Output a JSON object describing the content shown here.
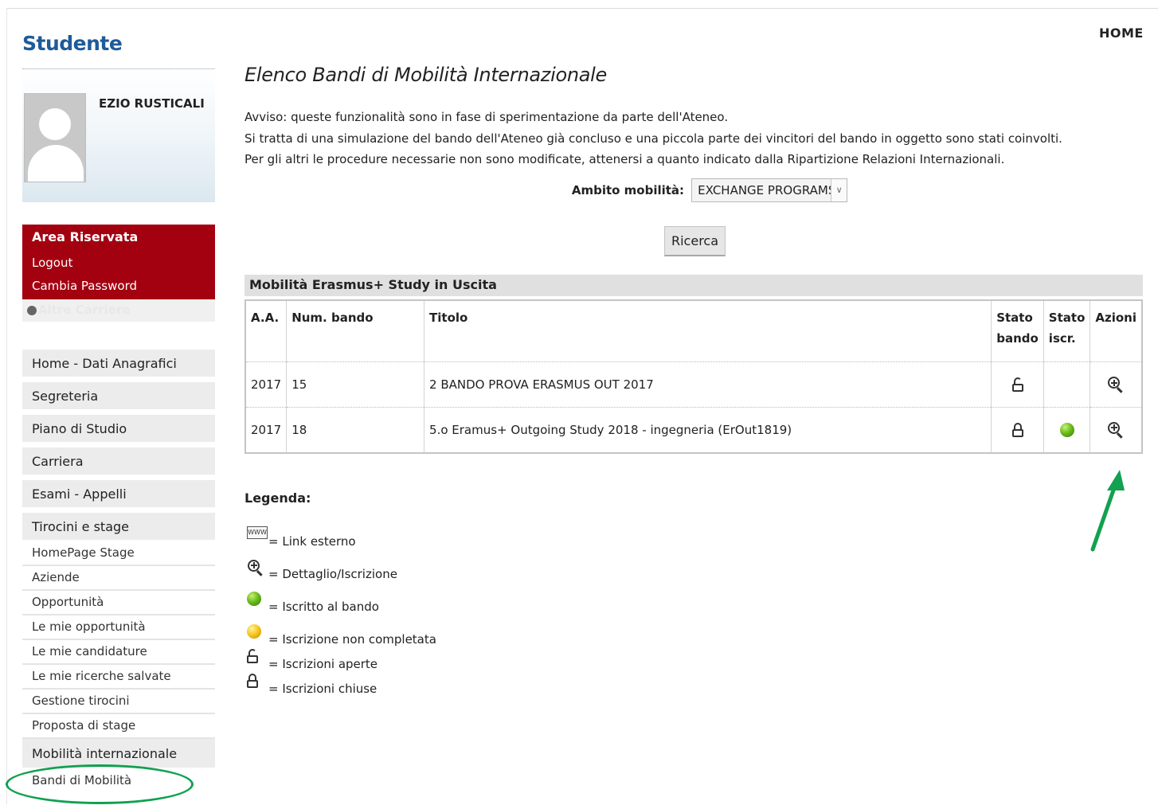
{
  "header": {
    "home_label": "HOME"
  },
  "sidebar": {
    "title": "Studente",
    "user_name": "EZIO RUSTICALI",
    "reserved": {
      "title": "Area Riservata",
      "logout": "Logout",
      "change_password": "Cambia Password",
      "other_careers": "Altre Carriere"
    },
    "menu": [
      {
        "label": "Home - Dati Anagrafici"
      },
      {
        "label": "Segreteria"
      },
      {
        "label": "Piano di Studio"
      },
      {
        "label": "Carriera"
      },
      {
        "label": "Esami - Appelli"
      },
      {
        "label": "Tirocini e stage"
      }
    ],
    "stage_items": [
      {
        "label": "HomePage Stage"
      },
      {
        "label": "Aziende"
      },
      {
        "label": "Opportunità"
      },
      {
        "label": "Le mie opportunità"
      },
      {
        "label": "Le mie candidature"
      },
      {
        "label": "Le mie ricerche salvate"
      },
      {
        "label": "Gestione tirocini"
      },
      {
        "label": "Proposta di stage"
      }
    ],
    "mobility_section": "Mobilità internazionale",
    "mobility_items": [
      {
        "label": "Bandi di Mobilità"
      }
    ]
  },
  "main": {
    "title": "Elenco Bandi di Mobilità Internazionale",
    "notice_lines": [
      "Avviso: queste funzionalità sono in fase di sperimentazione da parte dell'Ateneo.",
      "Si tratta di una simulazione del bando dell'Ateneo già concluso e una piccola parte dei vincitori del bando in oggetto sono stati coinvolti.",
      "Per gli altri le procedure necessarie non sono modificate, attenersi a quanto indicato dalla Ripartizione Relazioni Internazionali."
    ],
    "filter": {
      "label": "Ambito mobilità:",
      "selected": "EXCHANGE PROGRAMS"
    },
    "search_button": "Ricerca",
    "section_title": "Mobilità Erasmus+ Study in Uscita",
    "table": {
      "headers": {
        "aa": "A.A.",
        "num": "Num. bando",
        "title": "Titolo",
        "stato_bando_1": "Stato",
        "stato_bando_2": "bando",
        "stato_iscr_1": "Stato",
        "stato_iscr_2": "iscr.",
        "azioni": "Azioni"
      },
      "rows": [
        {
          "aa": "2017",
          "num": "15",
          "title": "2 BANDO PROVA ERASMUS OUT 2017",
          "stato_bando": "open-lock-icon",
          "stato_iscr": "",
          "azioni": "zoom-in-icon"
        },
        {
          "aa": "2017",
          "num": "18",
          "title": "5.o Eramus+ Outgoing Study 2018 - ingegneria (ErOut1819)",
          "stato_bando": "closed-lock-icon",
          "stato_iscr": "green-ball-icon",
          "azioni": "zoom-in-icon"
        }
      ]
    },
    "legend": {
      "title": "Legenda:",
      "www_text": "WWW",
      "items": [
        {
          "icon": "www-link-icon",
          "text": "= Link esterno"
        },
        {
          "icon": "zoom-in-icon",
          "text": "= Dettaglio/Iscrizione"
        },
        {
          "icon": "green-ball-icon",
          "text": "= Iscritto al bando"
        },
        {
          "icon": "yellow-ball-icon",
          "text": "= Iscrizione non completata"
        },
        {
          "icon": "open-lock-icon",
          "text": "= Iscrizioni aperte"
        },
        {
          "icon": "closed-lock-icon",
          "text": "= Iscrizioni chiuse"
        }
      ]
    }
  },
  "colors": {
    "brand_blue": "#1e5b99",
    "reserved_red": "#a30010",
    "annotation_green": "#12a150"
  }
}
